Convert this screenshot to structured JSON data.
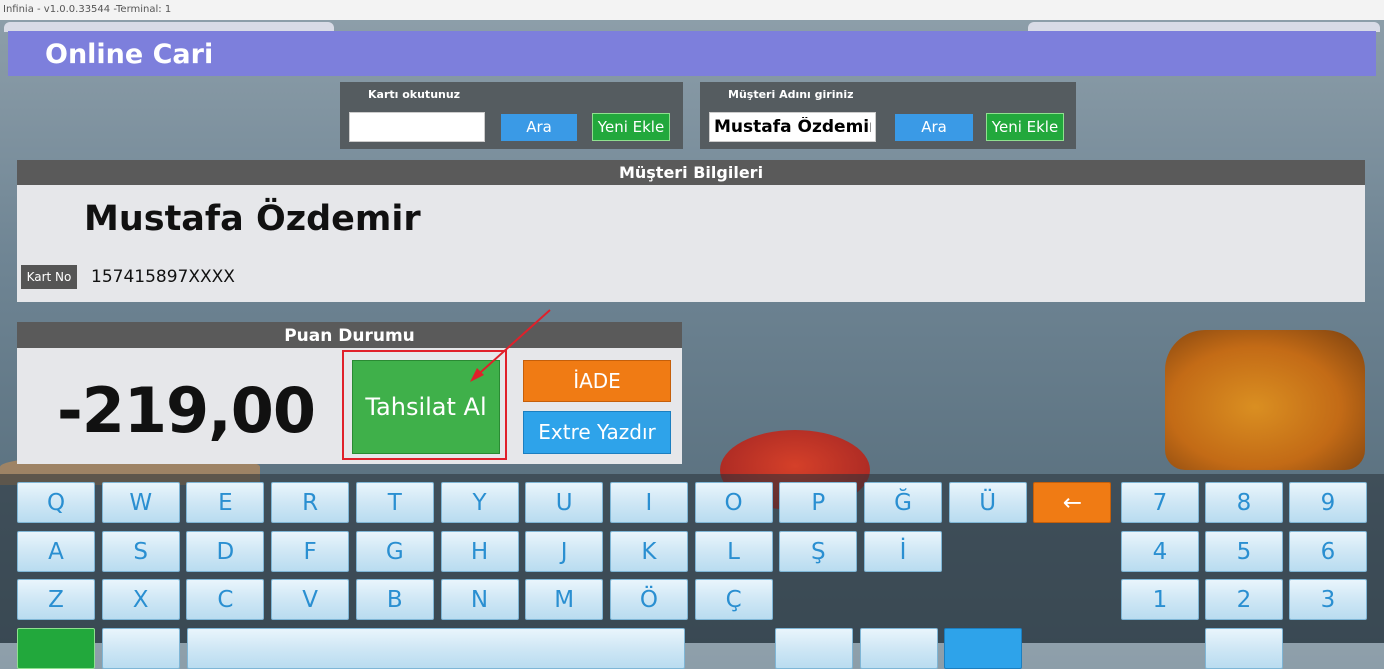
{
  "window": {
    "title": "Infinia - v1.0.0.33544 -Terminal: 1"
  },
  "header": {
    "title": "Online Cari"
  },
  "card_search": {
    "label": "Kartı okutunuz",
    "value": "",
    "search_label": "Ara",
    "add_label": "Yeni Ekle"
  },
  "name_search": {
    "label": "Müşteri Adını giriniz",
    "value": "Mustafa Özdemir",
    "search_label": "Ara",
    "add_label": "Yeni Ekle"
  },
  "customer": {
    "section_title": "Müşteri Bilgileri",
    "name": "Mustafa Özdemir",
    "card_label": "Kart No",
    "card_no": "157415897XXXX"
  },
  "points": {
    "section_title": "Puan Durumu",
    "balance": "-219,00",
    "collect_label": "Tahsilat Al",
    "refund_label": "İADE",
    "statement_label": "Extre Yazdır"
  },
  "keyboard": {
    "row1": [
      "Q",
      "W",
      "E",
      "R",
      "T",
      "Y",
      "U",
      "I",
      "O",
      "P",
      "Ğ",
      "Ü"
    ],
    "row2": [
      "A",
      "S",
      "D",
      "F",
      "G",
      "H",
      "J",
      "K",
      "L",
      "Ş",
      "İ"
    ],
    "row3": [
      "Z",
      "X",
      "C",
      "V",
      "B",
      "N",
      "M",
      "Ö",
      "Ç"
    ],
    "backspace": "←",
    "numpad": [
      [
        "7",
        "8",
        "9"
      ],
      [
        "4",
        "5",
        "6"
      ],
      [
        "1",
        "2",
        "3"
      ]
    ]
  },
  "colors": {
    "header": "#7d7fdc",
    "accent_blue": "#3a9ae6",
    "accent_green": "#22a83c",
    "accent_orange": "#f07b14",
    "highlight": "#e0202a"
  }
}
